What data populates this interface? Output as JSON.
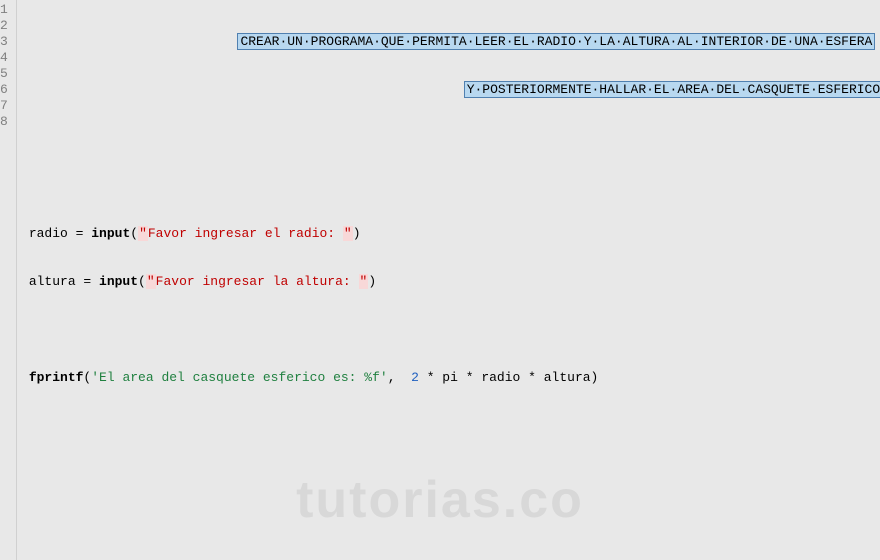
{
  "gutter": {
    "lines": [
      "1",
      "2",
      "3",
      "4",
      "5",
      "6",
      "7",
      "8"
    ]
  },
  "code": {
    "commentLine1": "CREAR·UN·PROGRAMA·QUE·PERMITA·LEER·EL·RADIO·Y·LA·ALTURA·AL·INTERIOR·DE·UNA·ESFERA",
    "commentLine2": "Y·POSTERIORMENTE·HALLAR·EL·AREA·DEL·CASQUETE·ESFERICO",
    "l5_var": "radio = ",
    "l5_func": "input",
    "l5_open": "(",
    "l5_q1": "\"",
    "l5_str": "Favor ingresar el radio: ",
    "l5_q2": "\"",
    "l5_close": ")",
    "l6_var": "altura = ",
    "l6_func": "input",
    "l6_open": "(",
    "l6_q1": "\"",
    "l6_str": "Favor ingresar la altura: ",
    "l6_q2": "\"",
    "l6_close": ")",
    "l8_func": "fprintf",
    "l8_open": "(",
    "l8_str": "'El area del casquete esferico es: %f'",
    "l8_comma": ",  ",
    "l8_num": "2",
    "l8_rest1": " * pi * ",
    "l8_rest2": "radio * altura)"
  },
  "watermark": "tutorias.co"
}
